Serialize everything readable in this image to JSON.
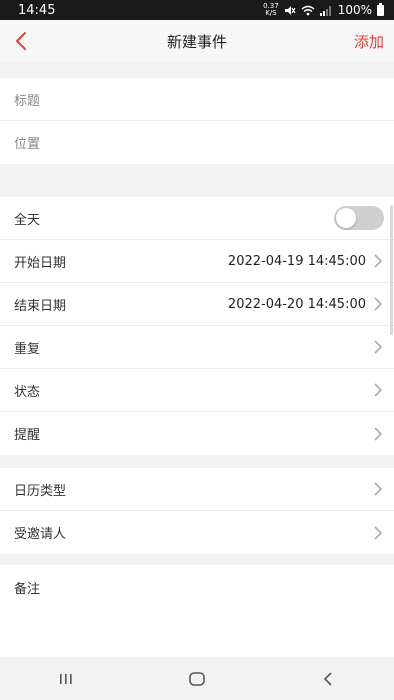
{
  "status_bar": {
    "time": "14:45",
    "net_speed_top": "0.37",
    "net_speed_bottom": "K/S",
    "battery": "100%"
  },
  "header": {
    "title": "新建事件",
    "add_label": "添加",
    "back_icon": "chevron-left-icon",
    "accent_color": "#e0413e"
  },
  "basic": {
    "title_placeholder": "标题",
    "location_placeholder": "位置"
  },
  "schedule": {
    "all_day_label": "全天",
    "all_day_on": false,
    "start_label": "开始日期",
    "start_value": "2022-04-19 14:45:00",
    "end_label": "结束日期",
    "end_value": "2022-04-20 14:45:00",
    "repeat_label": "重复",
    "status_label": "状态",
    "reminder_label": "提醒"
  },
  "extra": {
    "calendar_type_label": "日历类型",
    "invitees_label": "受邀请人"
  },
  "notes": {
    "label": "备注"
  },
  "nav": {
    "recents_icon": "recents-icon",
    "home_icon": "home-icon",
    "back_icon": "back-icon"
  }
}
